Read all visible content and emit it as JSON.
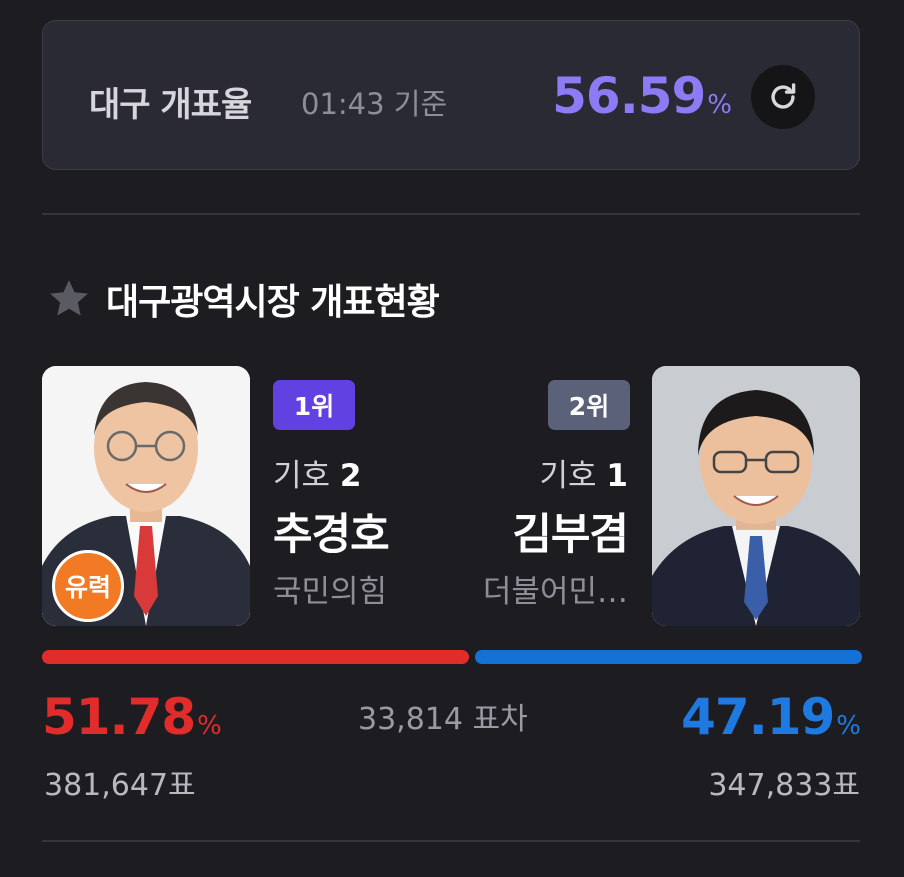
{
  "turnout": {
    "title": "대구 개표율",
    "time": "01:43 기준",
    "value": "56.59",
    "unit": "%",
    "refresh_icon": "refresh-icon"
  },
  "section": {
    "icon": "star-icon",
    "title": "대구광역시장 개표현황"
  },
  "candidates": [
    {
      "rank": "1위",
      "number_label": "기호",
      "number": "2",
      "name": "추경호",
      "party": "국민의힘",
      "badge": "유력",
      "percent": "51.78",
      "unit": "%",
      "votes": "381,647표",
      "color": "#e22b2b"
    },
    {
      "rank": "2위",
      "number_label": "기호",
      "number": "1",
      "name": "김부겸",
      "party": "더불어민…",
      "percent": "47.19",
      "unit": "%",
      "votes": "347,833표",
      "color": "#1e7ae0"
    }
  ],
  "vote_gap": "33,814 표차",
  "accent_color": "#8b7cf6"
}
